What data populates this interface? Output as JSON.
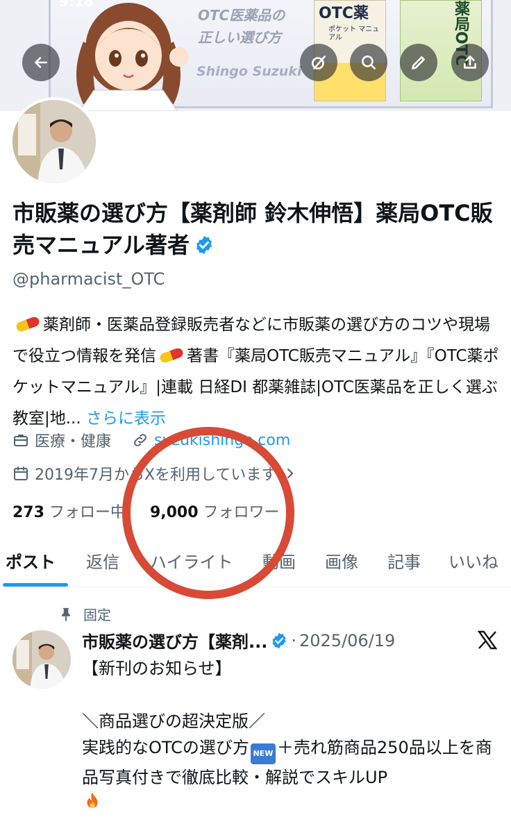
{
  "status_bar": {
    "time": "9:18"
  },
  "banner": {
    "line1": "OTC医薬品の",
    "line2": "正しい選び方",
    "author": "Shingo Suzuki",
    "book1_title": "OTC薬",
    "book1_subtitle": "ポケット\nマニュアル",
    "book2_title": "薬局OTC"
  },
  "nav": {
    "back_icon": "arrow-left-icon",
    "grok_icon": "grok-icon",
    "search_icon": "search-icon",
    "edit_icon": "pencil-icon",
    "share_icon": "share-icon"
  },
  "profile": {
    "name": "市販薬の選び方【薬剤師 鈴木伸悟】薬局OTC販売マニュアル著者",
    "handle": "@pharmacist_OTC",
    "bio_part1": "薬剤師・医薬品登録販売者などに市販薬の選び方のコツや現場で役立つ情報を発信",
    "bio_part2": "著書『薬局OTC販売マニュアル』『OTC薬ポケットマニュアル』|連載 日経DI 都薬雑誌|OTC医薬品を正しく選ぶ教室|地...",
    "bio_more": "さらに表示",
    "category": "医療・健康",
    "website": "suzukishingo.com",
    "joined": "2019年7月からXを利用しています",
    "following_count": "273",
    "following_label": "フォロー中",
    "followers_count": "9,000",
    "followers_label": "フォロワー",
    "verified_color": "#1d9bf0"
  },
  "tabs": [
    {
      "label": "ポスト",
      "active": true
    },
    {
      "label": "返信"
    },
    {
      "label": "ハイライト"
    },
    {
      "label": "動画"
    },
    {
      "label": "画像"
    },
    {
      "label": "記事"
    },
    {
      "label": "いいね"
    }
  ],
  "pinned_post": {
    "pinned_label": "固定",
    "author": "市販薬の選び方【薬剤...",
    "separator": "·",
    "date": "2025/06/19",
    "line1": "【新刊のお知らせ】",
    "line2": "＼商品選びの超決定版／",
    "line3a": "実践的なOTCの選び方",
    "line3b": "＋売れ筋商品250品以上を商品写真付きで徹底比較・解説でスキルUP",
    "new_badge": "NEW"
  },
  "annotation": {
    "color": "#d84a36"
  }
}
